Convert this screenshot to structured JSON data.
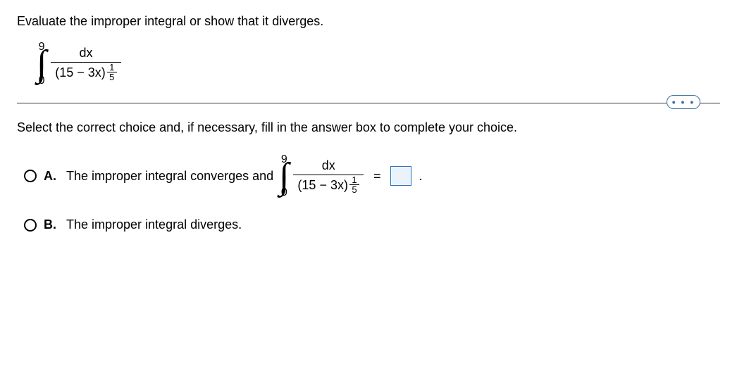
{
  "question": {
    "prompt": "Evaluate the improper integral or show that it diverges.",
    "integral": {
      "upper": "9",
      "lower": "0",
      "numerator": "dx",
      "base": "(15 − 3x)",
      "exp_num": "1",
      "exp_den": "5"
    }
  },
  "divider_icon": "• • •",
  "instruction": "Select the correct choice and, if necessary, fill in the answer box to complete your choice.",
  "choices": {
    "a": {
      "label": "A.",
      "text_before": "The improper integral converges and",
      "equals": "=",
      "period": "."
    },
    "b": {
      "label": "B.",
      "text": "The improper integral diverges."
    }
  }
}
